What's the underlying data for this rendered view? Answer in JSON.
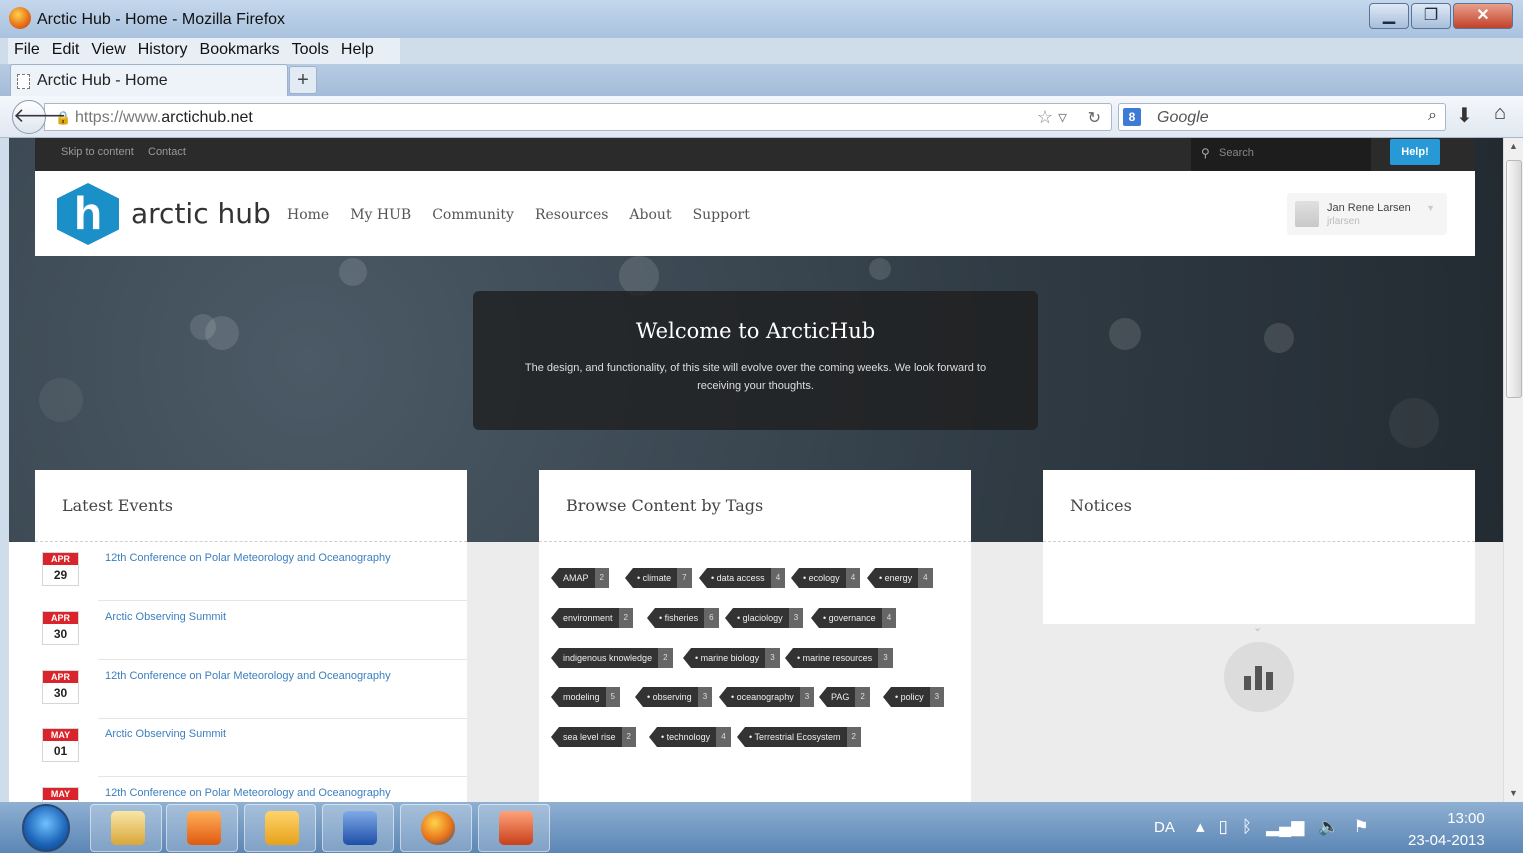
{
  "window": {
    "title": "Arctic Hub - Home - Mozilla Firefox"
  },
  "menubar": [
    "File",
    "Edit",
    "View",
    "History",
    "Bookmarks",
    "Tools",
    "Help"
  ],
  "tab": {
    "title": "Arctic Hub - Home",
    "new_tab": "+"
  },
  "nav": {
    "url_protocol": "https://www.",
    "url_host": "arctichub.net",
    "search_engine_badge": "8",
    "search_placeholder": "Google"
  },
  "site": {
    "top_links": [
      "Skip to content",
      "Contact"
    ],
    "search_placeholder": "Search",
    "help_label": "Help!",
    "logo_letter": "h",
    "logo_text": "arctic hub",
    "main_nav": [
      "Home",
      "My HUB",
      "Community",
      "Resources",
      "About",
      "Support"
    ],
    "user": {
      "name": "Jan Rene Larsen",
      "username": "jrlarsen"
    }
  },
  "welcome": {
    "title": "Welcome to ArcticHub",
    "text": "The design, and functionality, of this site will evolve over the coming weeks. We look forward to receiving your thoughts."
  },
  "panels": {
    "events_title": "Latest Events",
    "tags_title": "Browse Content by Tags",
    "notices_title": "Notices"
  },
  "events": [
    {
      "month": "APR",
      "day": "29",
      "title": "12th Conference on Polar Meteorology and Oceanography"
    },
    {
      "month": "APR",
      "day": "30",
      "title": "Arctic Observing Summit"
    },
    {
      "month": "APR",
      "day": "30",
      "title": "12th Conference on Polar Meteorology and Oceanography"
    },
    {
      "month": "MAY",
      "day": "01",
      "title": "Arctic Observing Summit"
    },
    {
      "month": "MAY",
      "day": "",
      "title": "12th Conference on Polar Meteorology and Oceanography"
    }
  ],
  "tags": [
    {
      "name": "AMAP",
      "count": "2"
    },
    {
      "name": "• climate",
      "count": "7"
    },
    {
      "name": "• data access",
      "count": "4"
    },
    {
      "name": "• ecology",
      "count": "4"
    },
    {
      "name": "• energy",
      "count": "4"
    },
    {
      "name": "environment",
      "count": "2"
    },
    {
      "name": "• fisheries",
      "count": "6"
    },
    {
      "name": "• glaciology",
      "count": "3"
    },
    {
      "name": "• governance",
      "count": "4"
    },
    {
      "name": "indigenous knowledge",
      "count": "2"
    },
    {
      "name": "• marine biology",
      "count": "3"
    },
    {
      "name": "• marine resources",
      "count": "3"
    },
    {
      "name": "modeling",
      "count": "5"
    },
    {
      "name": "• observing",
      "count": "3"
    },
    {
      "name": "• oceanography",
      "count": "3"
    },
    {
      "name": "PAG",
      "count": "2"
    },
    {
      "name": "• policy",
      "count": "3"
    },
    {
      "name": "sea level rise",
      "count": "2"
    },
    {
      "name": "• technology",
      "count": "4"
    },
    {
      "name": "• Terrestrial Ecosystem",
      "count": "2"
    }
  ],
  "taskbar": {
    "language": "DA",
    "time": "13:00",
    "date": "23-04-2013"
  },
  "colors": {
    "brand_blue": "#1b8fc8",
    "help_button": "#2699d6",
    "event_month_red": "#d9242c",
    "link_blue": "#3b7fbf"
  }
}
